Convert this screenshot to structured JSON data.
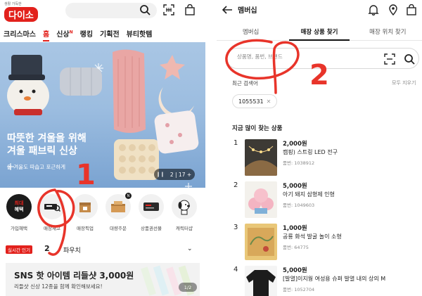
{
  "left": {
    "logo": {
      "tagline": "생활 가득한",
      "brand": "다이소"
    },
    "tabs": [
      {
        "label": "크리스마스"
      },
      {
        "label": "홈"
      },
      {
        "label": "신상",
        "badge": "N"
      },
      {
        "label": "랭킹"
      },
      {
        "label": "기획전"
      },
      {
        "label": "뷰티핫템"
      }
    ],
    "banner": {
      "title_line1": "따뜻한 겨울을 위해",
      "title_line2": "겨울 패브릭 신상",
      "subtitle": "올 겨울도 따숩고 포근하게",
      "page_indicator": "2 | 17 +"
    },
    "quick_menu": [
      {
        "label": "가입혜택",
        "icon": "benefit-icon",
        "text_top": "최대",
        "text_bottom": "혜택"
      },
      {
        "label": "매장재고",
        "icon": "store-stock-icon"
      },
      {
        "label": "매장픽업",
        "icon": "store-pickup-icon"
      },
      {
        "label": "대량주문",
        "icon": "bulk-order-icon",
        "badge": "N"
      },
      {
        "label": "상품권선물",
        "icon": "gift-card-icon"
      },
      {
        "label": "캐릭터샵",
        "icon": "character-shop-icon"
      }
    ],
    "trending": {
      "badge": "실시간 인기",
      "rank": "2",
      "keyword": "파우치"
    },
    "promo": {
      "title": "SNS 핫 아이템 리들샷 3,000원",
      "subtitle": "리들샷 신상 12종을 함께 확인해보세요!",
      "indicator": "1/2"
    }
  },
  "right": {
    "title": "멤버십",
    "tabs": [
      {
        "label": "멤버십"
      },
      {
        "label": "매장 상품 찾기"
      },
      {
        "label": "매장 위치 찾기"
      }
    ],
    "search": {
      "placeholder": "상품명, 품번, 브랜드"
    },
    "recent": {
      "label": "최근 검색어",
      "clear_label": "모두 지우기",
      "chips": [
        "1055531"
      ]
    },
    "section_title": "지금 많이 찾는 상품",
    "products": [
      {
        "rank": "1",
        "price": "2,000원",
        "name": "캠핑) 스트링 LED 전구",
        "number": "품번: 1038912"
      },
      {
        "rank": "2",
        "price": "5,000원",
        "name": "아기 돼지 삼형제 인형",
        "number": "품번: 1049603"
      },
      {
        "rank": "3",
        "price": "1,000원",
        "name": "공룡 화석 발굴 놀이 소형",
        "number": "품번: 64775"
      },
      {
        "rank": "4",
        "price": "5,000원",
        "name": "[발열]이지웜 여성용 슈퍼 발열 내의 상의 M",
        "number": "품번: 1052704"
      }
    ]
  },
  "annotations": {
    "step1": "1",
    "step2": "2"
  },
  "colors": {
    "brand_red": "#e2211c",
    "annotation_red": "#e8342a"
  }
}
